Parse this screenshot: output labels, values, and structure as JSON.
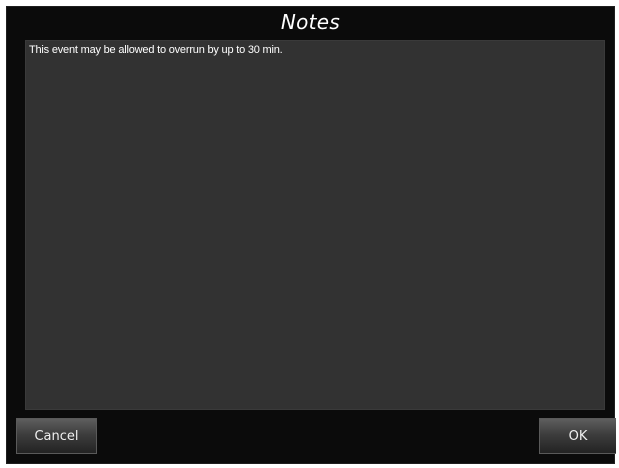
{
  "dialog": {
    "title": "Notes",
    "notes_text": "This event may be allowed to overrun by up to 30 min.",
    "cancel_label": "Cancel",
    "ok_label": "OK"
  },
  "colors": {
    "background": "#0b0b0b",
    "text_area": "#323232",
    "text": "#ffffff"
  }
}
